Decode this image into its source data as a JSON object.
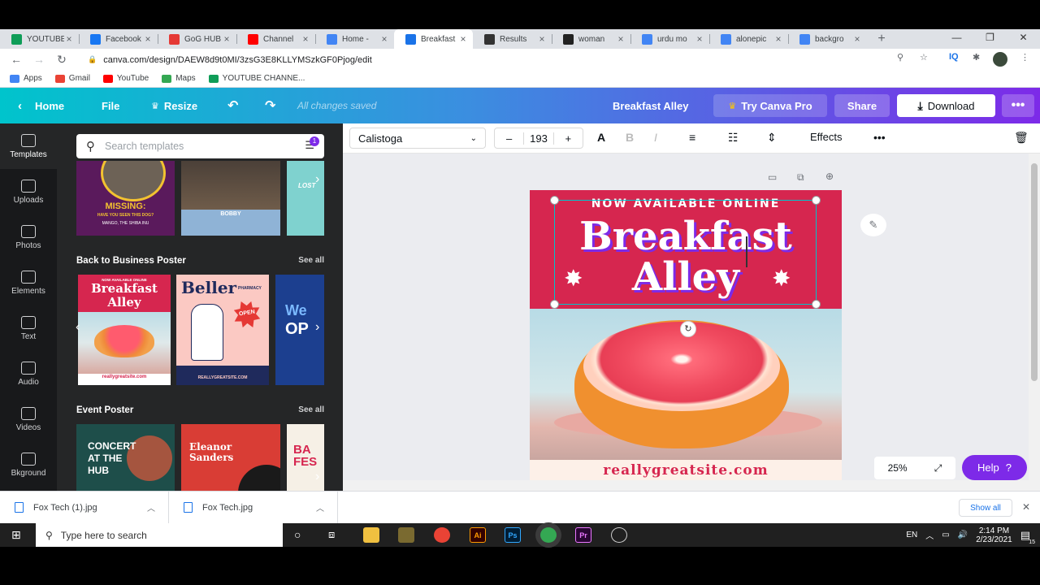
{
  "browser": {
    "tabs": [
      {
        "title": "YOUTUBE",
        "color": "#0f9d58"
      },
      {
        "title": "Facebook",
        "color": "#1877f2"
      },
      {
        "title": "GoG HUB",
        "color": "#e53935"
      },
      {
        "title": "Channel",
        "color": "#ff0000"
      },
      {
        "title": "Home -",
        "color": "#4285f4"
      },
      {
        "title": "Breakfast",
        "color": "#1a73e8",
        "active": true
      },
      {
        "title": "Results",
        "color": "#333333"
      },
      {
        "title": "woman",
        "color": "#222222"
      },
      {
        "title": "urdu mo",
        "color": "#4285f4"
      },
      {
        "title": "alonepic",
        "color": "#4285f4"
      },
      {
        "title": "backgro",
        "color": "#4285f4"
      }
    ],
    "new_tab": "+",
    "url": "canva.com/design/DAEW8d9t0MI/3zsG3E8KLLYMSzkGF0Pjog/edit",
    "bookmarks": [
      {
        "label": "Apps",
        "color": "#4285f4"
      },
      {
        "label": "Gmail",
        "color": "#ea4335"
      },
      {
        "label": "YouTube",
        "color": "#ff0000"
      },
      {
        "label": "Maps",
        "color": "#34a853"
      },
      {
        "label": "YOUTUBE CHANNE...",
        "color": "#0f9d58"
      }
    ],
    "ext_iq": "IQ"
  },
  "header": {
    "home": "Home",
    "file": "File",
    "resize": "Resize",
    "saved": "All changes saved",
    "design_title": "Breakfast Alley",
    "try_pro": "Try Canva Pro",
    "share": "Share",
    "download": "Download"
  },
  "rail": [
    {
      "label": "Templates",
      "icon": "templates-icon"
    },
    {
      "label": "Uploads",
      "icon": "upload-cloud-icon"
    },
    {
      "label": "Photos",
      "icon": "photo-icon"
    },
    {
      "label": "Elements",
      "icon": "elements-icon"
    },
    {
      "label": "Text",
      "icon": "text-icon"
    },
    {
      "label": "Audio",
      "icon": "music-note-icon"
    },
    {
      "label": "Videos",
      "icon": "video-icon"
    },
    {
      "label": "Bkground",
      "icon": "background-icon"
    }
  ],
  "panel": {
    "search_placeholder": "Search templates",
    "filter_badge": "1",
    "sections": [
      {
        "title": "Back to Business Poster",
        "see_all": "See all"
      },
      {
        "title": "Event Poster",
        "see_all": "See all"
      }
    ],
    "thumbs_top": [
      {
        "big": "MISSING:",
        "small": "HAVE YOU SEEN THIS DOG?",
        "tiny": "MANGO, THE SHIBA INU"
      },
      {
        "big": "BOBBY",
        "small": ""
      },
      {
        "big": "LOST",
        "small": ""
      }
    ],
    "thumbs_business": [
      {
        "line1": "NOW AVAILABLE ONLINE",
        "line2": "Breakfast",
        "line3": "Alley",
        "site": "reallygreatsite.com"
      },
      {
        "line1": "Beller",
        "line2": "PHARMACY",
        "badge": "OPEN",
        "site": "REALLYGREATSITE.COM"
      },
      {
        "line1": "We",
        "line2": "OP"
      }
    ],
    "thumbs_event": [
      {
        "line1": "CONCERT",
        "line2": "AT THE",
        "line3": "HUB"
      },
      {
        "line1": "Eleanor",
        "line2": "Sanders"
      },
      {
        "line1": "BA",
        "line2": "FES"
      }
    ]
  },
  "toolbar": {
    "font": "Calistoga",
    "size": "193",
    "minus": "–",
    "plus": "+",
    "effects": "Effects"
  },
  "design": {
    "top_line": "NOW AVAILABLE ONLINE",
    "title_line1": "Breakfast",
    "title_line2": "Alley",
    "site": "reallygreatsite.com",
    "band_color": "#d6264f",
    "shadow_color": "#7d2ae8"
  },
  "zoom": {
    "level": "25%"
  },
  "help": {
    "label": "Help",
    "mark": "?"
  },
  "downloads": {
    "files": [
      "Fox Tech (1).jpg",
      "Fox Tech.jpg"
    ],
    "show_all": "Show all"
  },
  "taskbar": {
    "search_placeholder": "Type here to search",
    "lang": "EN",
    "time": "2:14 PM",
    "date": "2/23/2021",
    "notif": "15",
    "apps": [
      {
        "label": "Ai",
        "bg": "#330000",
        "fg": "#ff9a00"
      },
      {
        "label": "Ps",
        "bg": "#001e36",
        "fg": "#31a8ff"
      },
      {
        "label": "Pr",
        "bg": "#2a0634",
        "fg": "#ea77ff"
      }
    ]
  }
}
